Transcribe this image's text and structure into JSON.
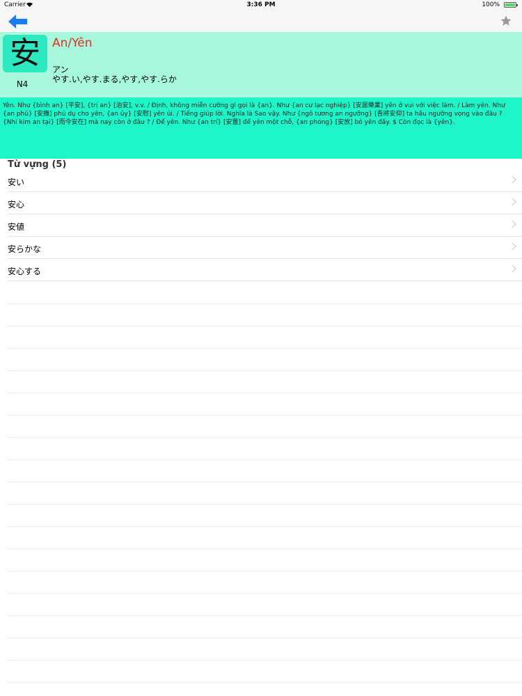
{
  "status_bar": {
    "carrier": "Carrier",
    "time": "3:36 PM",
    "battery": "100%"
  },
  "nav": {
    "back_icon": "back-arrow-icon",
    "favorite_icon": "star-icon",
    "accent_color": "#1a7cf4"
  },
  "kanji": {
    "character": "安",
    "han_viet": "An/Yên",
    "on_reading": "アン",
    "kun_reading": "やす.い,やす.まる,やす,やす.らか",
    "level": "N4",
    "meaning": "Yên. Như {bình an} [平安], {trị an} [治安], v.v. / Định, không miễn cưỡng gì gọi là {an}. Như {an cư lạc nghiệp} [安居樂業] yên ở vui với việc làm. / Làm yên. Như {an phủ} [安撫] phủ dụ cho yên, {an ủy} [安慰] yên ủi. / Tiếng giúp lời. Nghĩa là Sao vậy. Như {ngô tương an ngưỡng} [吾將安仰] ta hầu ngưỡng vọng vào đâu ? {Nhi kim an tại} [而今安在] mà nay còn ở đâu ? / Để yên. Như {an trí} [安置] để yên một chỗ, {an phóng} [安放] bỏ yên đấy. $ Còn đọc là {yên}."
  },
  "vocab": {
    "header": "Từ vựng (5)",
    "items": [
      "安い",
      "安心",
      "安値",
      "安らかな",
      "安心する"
    ]
  }
}
